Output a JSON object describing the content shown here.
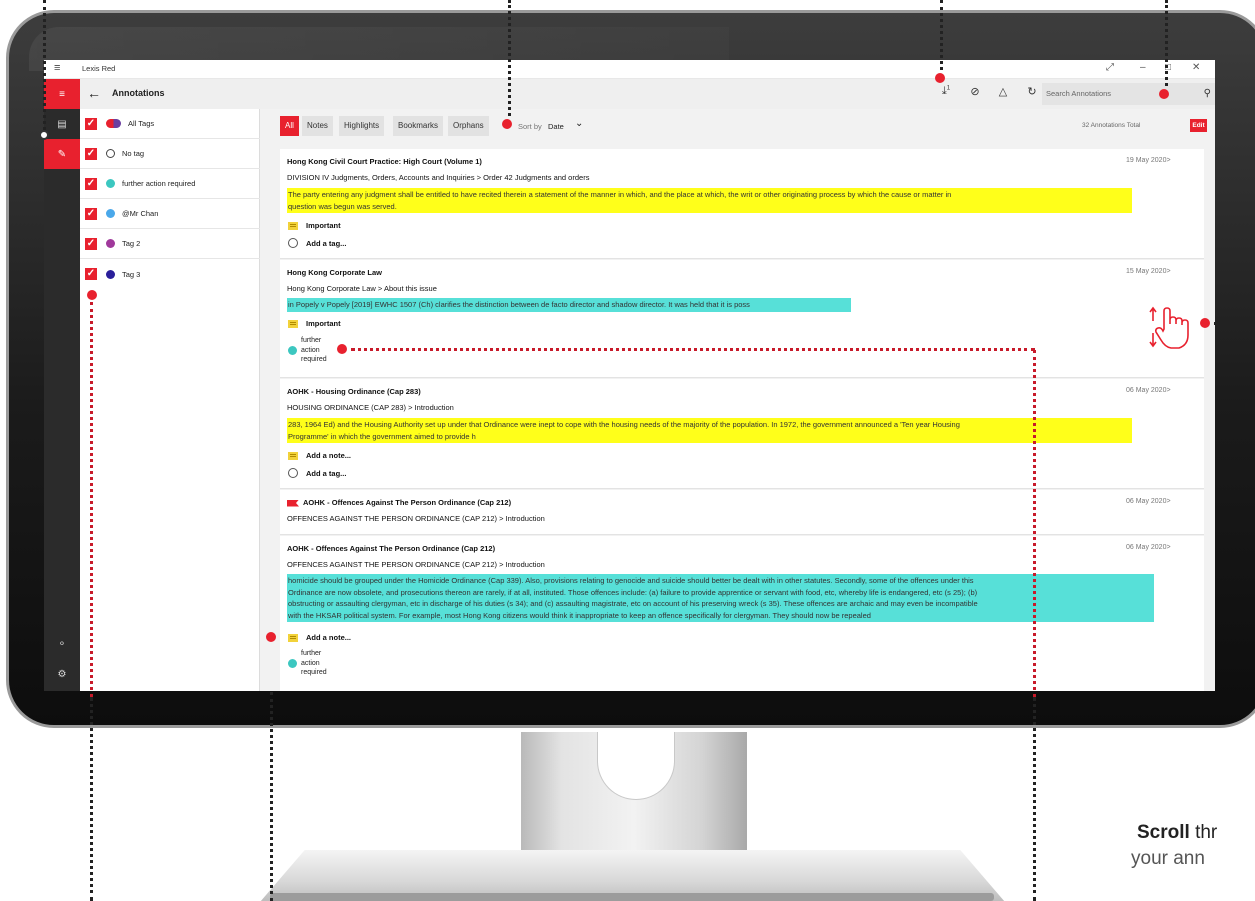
{
  "window": {
    "app_title": "Lexis Red"
  },
  "header": {
    "title": "Annotations",
    "download_badge": "1",
    "search_placeholder": "Search Annotations"
  },
  "tags": [
    {
      "label": "All Tags",
      "dot": "multi"
    },
    {
      "label": "No tag",
      "dot": "hollow"
    },
    {
      "label": "further action required",
      "dot": "#3cc7c0"
    },
    {
      "label": "@Mr Chan",
      "dot": "#4aa8ea"
    },
    {
      "label": "Tag 2",
      "dot": "#a0399b"
    },
    {
      "label": "Tag 3",
      "dot": "#2a1f9a"
    }
  ],
  "filters": {
    "tabs": [
      "All",
      "Notes",
      "Highlights",
      "Bookmarks",
      "Orphans"
    ],
    "sort_label": "Sort by",
    "sort_value": "Date",
    "total": "32 Annotations Total",
    "edit_label": "Edit"
  },
  "annotations": [
    {
      "title": "Hong Kong Civil Court Practice: High Court (Volume 1)",
      "date": "19 May 2020>",
      "path": "DIVISION IV Judgments, Orders, Accounts and Inquiries > Order 42 Judgments and orders",
      "highlight_color": "yellow",
      "text_line1": "The party entering any judgment shall be entitled to have recited therein a statement of the manner in which, and the place at which, the writ or other originating process by which the cause or matter in",
      "text_line2": "question was begun was served.",
      "note": "Important",
      "tag_action": "Add a tag..."
    },
    {
      "title": "Hong Kong Corporate Law",
      "date": "15 May 2020>",
      "path": "Hong Kong Corporate Law > About this issue",
      "highlight_color": "cyan",
      "text_line1": "in Popely v Popely [2019] EWHC 1507 (Ch) clarifies the distinction between de facto director and shadow director. It was held that it is poss",
      "note": "Important",
      "tag_line1": "further",
      "tag_line2": "action",
      "tag_line3": "required"
    },
    {
      "title": "AOHK - Housing Ordinance (Cap 283)",
      "date": "06 May 2020>",
      "path": "HOUSING ORDINANCE (CAP 283) > Introduction",
      "highlight_color": "yellow",
      "text_line1": "283, 1964 Ed) and the Housing Authority set up under that Ordinance were inept to cope with the housing needs of the majority of the population. In 1972, the government announced a 'Ten year Housing",
      "text_line2": "Programme' in which the government aimed to provide h",
      "note": "Add a note...",
      "tag_action": "Add a tag..."
    },
    {
      "title": "AOHK - Offences Against The Person Ordinance (Cap 212)",
      "date": "06 May 2020>",
      "path": "OFFENCES AGAINST THE PERSON ORDINANCE (CAP 212) > Introduction"
    },
    {
      "title": "AOHK - Offences Against The Person Ordinance (Cap 212)",
      "date": "06 May 2020>",
      "path": "OFFENCES AGAINST THE PERSON ORDINANCE (CAP 212) > Introduction",
      "highlight_color": "cyan",
      "text_line1": "homicide should be grouped under the Homicide Ordinance (Cap 339). Also, provisions relating to genocide and suicide should better be dealt with in other statutes. Secondly, some of the offences under this",
      "text_line2": "Ordinance are now obsolete, and prosecutions thereon are rarely, if at all, instituted. Those offences include: (a) failure to provide apprentice or servant with food, etc, whereby life is endangered, etc (s 25); (b)",
      "text_line3": "obstructing or assaulting clergyman, etc in discharge of his duties (s 34); and (c) assaulting magistrate, etc on account of his preserving wreck (s 35). These offences are archaic and may even be incompatible",
      "text_line4": "with the HKSAR political system. For example, most Hong Kong citizens would think it inappropriate to keep an offence specifically for clergyman. They should now be repealed",
      "note": "Add a note...",
      "tag_line1": "further",
      "tag_line2": "action",
      "tag_line3": "required"
    }
  ],
  "caption": {
    "bold": "Scroll",
    "rest": " thr",
    "line2": "your ann"
  },
  "colors": {
    "accent": "#e8212e",
    "highlight_yellow": "#ffff1a",
    "highlight_cyan": "#57e0d8"
  }
}
